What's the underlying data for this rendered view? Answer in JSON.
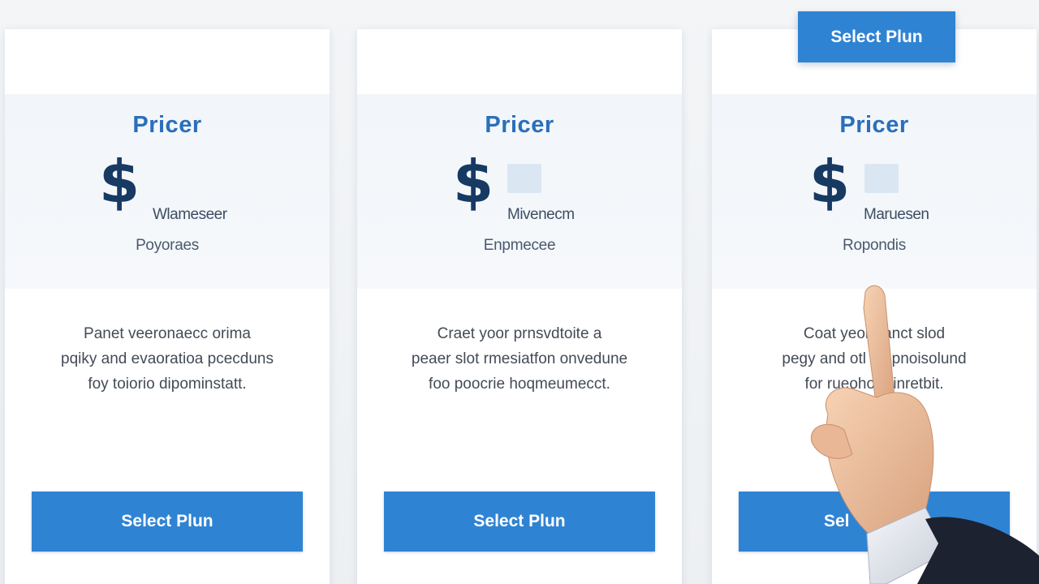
{
  "floating_button": {
    "label": "Select Plun"
  },
  "cards": [
    {
      "title": "Pricer",
      "currency": "$",
      "unit": "Wlameseer",
      "subtitle": "Poyoraes",
      "description": [
        "Panet veeronaecc orima",
        "pqiky and evaoratioa  pcecduns",
        "foy toiorio dipominstatt."
      ],
      "button": "Select Plun"
    },
    {
      "title": "Pricer",
      "currency": "$",
      "unit": "Mivenecm",
      "subtitle": "Enpmecee",
      "description": [
        "Craet yoor prnsvdtoite a",
        "peaer slot rmesiatfon onvedune",
        "foo poocrie hoqmeumecct."
      ],
      "button": "Select Plun"
    },
    {
      "title": "Pricer",
      "currency": "$",
      "unit": "Maruesen",
      "subtitle": "Ropondis",
      "description": [
        "Coat yeor   aanct slod",
        "pegy and otl   ad pnoisolund",
        "for rueoho   rpinretbit."
      ],
      "button": "Sel"
    }
  ],
  "colors": {
    "accent": "#2f83d3",
    "title": "#2a6fba",
    "dollar": "#173a63"
  },
  "icons": {
    "pointer": "pointing-hand-icon"
  }
}
